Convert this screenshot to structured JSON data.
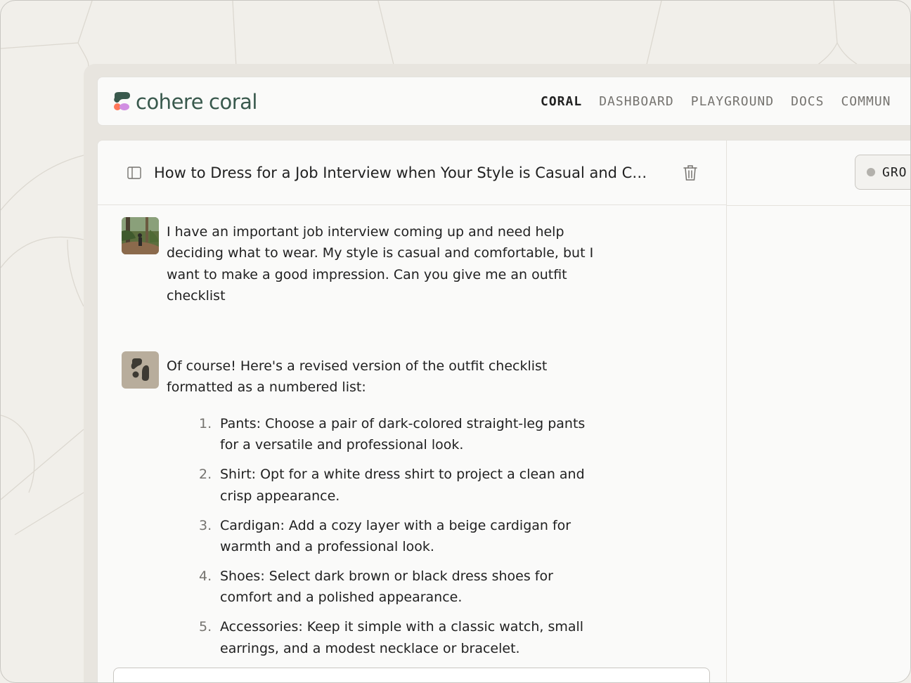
{
  "app": {
    "logo_primary": "cohere",
    "logo_secondary": "coral"
  },
  "nav": {
    "items": [
      {
        "label": "CORAL",
        "active": true
      },
      {
        "label": "DASHBOARD",
        "active": false
      },
      {
        "label": "PLAYGROUND",
        "active": false
      },
      {
        "label": "DOCS",
        "active": false
      },
      {
        "label": "COMMUN",
        "active": false
      }
    ]
  },
  "conversation": {
    "title": "How to Dress for a Job Interview when Your Style is Casual and C…",
    "user_message": "I have an important job interview coming up and need help deciding what to wear. My style is casual and comfortable, but I want to make a good impression. Can you give me an outfit checklist",
    "bot_intro": "Of course! Here's a revised version of the outfit checklist formatted as a numbered list:",
    "checklist": [
      {
        "num": "1.",
        "text": "Pants: Choose a pair of dark-colored straight-leg pants for a versatile and professional look."
      },
      {
        "num": "2.",
        "text": "Shirt: Opt for a white dress shirt to project a clean and crisp appearance."
      },
      {
        "num": "3.",
        "text": "Cardigan: Add a cozy layer with a beige cardigan for warmth and a professional look."
      },
      {
        "num": "4.",
        "text": "Shoes: Select dark brown or black dress shoes for comfort and a polished appearance."
      },
      {
        "num": "5.",
        "text": "Accessories: Keep it simple with a classic watch, small earrings, and a modest necklace or bracelet."
      }
    ]
  },
  "right_panel": {
    "grounding_label": "GRO"
  },
  "colors": {
    "brand_green": "#39594d",
    "logo_coral": "#ff7759",
    "logo_purple": "#d18ee2",
    "page_bg": "#f1efea",
    "panel_bg": "#fafaf9",
    "bot_avatar_bg": "#b8ad9c"
  },
  "icons": {
    "sidebar_toggle": "sidebar-toggle-icon",
    "trash": "trash-icon",
    "bot_avatar": "coral-bot-icon"
  }
}
